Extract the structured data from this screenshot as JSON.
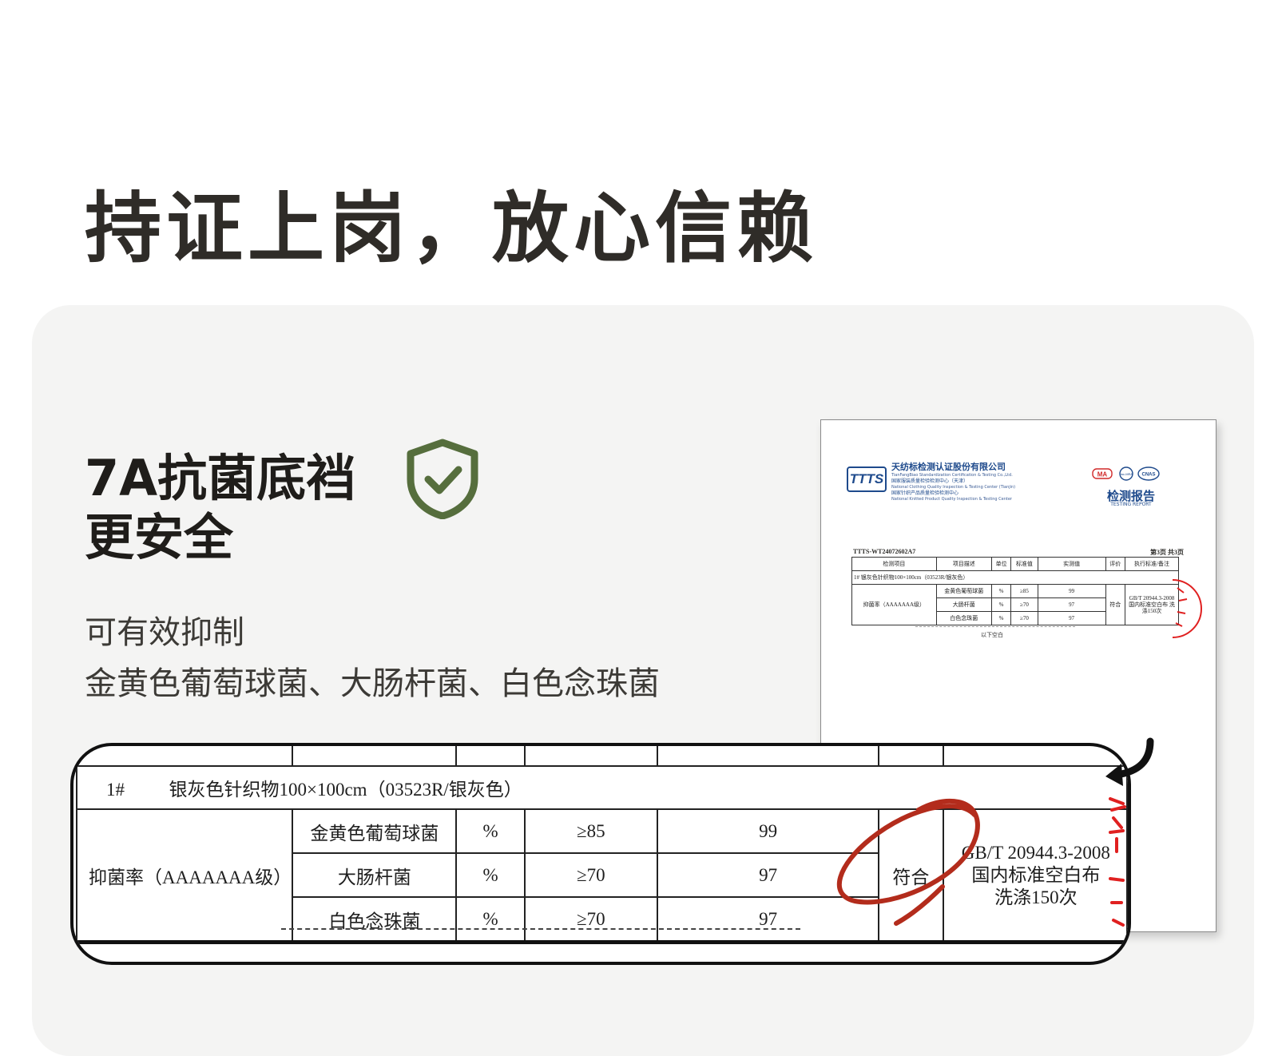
{
  "headline": "持证上岗，放心信赖",
  "feature": {
    "title_line1": "7A抗菌底裆",
    "title_line2": "更安全",
    "desc_line1": "可有效抑制",
    "desc_line2": "金黄色葡萄球菌、大肠杆菌、白色念珠菌"
  },
  "colors": {
    "shield": "#566e3d",
    "circle": "#b32c1c",
    "seal": "#e02020",
    "report_blue": "#1e4a8c"
  },
  "report": {
    "logo": "TTTS",
    "org_name": "天纺标检测认证股份有限公司",
    "org_sub": "TianFangBiao Standardization Certification & Testing Co.,Ltd.",
    "center1": "国家服装质量检验检测中心（天津）",
    "center1_en": "National Clothing Quality Inspection & Testing Center (Tianjin)",
    "center2": "国家针织产品质量检验检测中心",
    "center2_en": "National Knitted Product Quality Inspection & Testing Center",
    "badges": [
      "MA",
      "ilac-MRA",
      "CNAS"
    ],
    "doc_title": "检测报告",
    "doc_sub": "TESTING REPORT",
    "report_no": "TTTS-WT24072602A7",
    "page": "第3页 共3页",
    "headers": [
      "检测项目",
      "项目描述",
      "单位",
      "标准值",
      "实测值",
      "评价",
      "执行标准/备注"
    ],
    "sample_row": "1#     银灰色针织物100×100cm（03523R/银灰色）",
    "item": "抑菌率（AAAAAAA级）",
    "rows": [
      {
        "name": "金黄色葡萄球菌",
        "unit": "%",
        "standard": "≥85",
        "measured": "99"
      },
      {
        "name": "大肠杆菌",
        "unit": "%",
        "standard": "≥70",
        "measured": "97"
      },
      {
        "name": "白色念珠菌",
        "unit": "%",
        "standard": "≥70",
        "measured": "97"
      }
    ],
    "result": "符合",
    "std_note": "GB/T 20944.3-2008 国内标准空白布 洗涤150次",
    "end_note": "以下空白"
  },
  "zoom": {
    "sample_id": "1#",
    "sample_desc": "银灰色针织物100×100cm（03523R/银灰色）",
    "item": "抑菌率（AAAAAAA级）",
    "rows": [
      {
        "name": "金黄色葡萄球菌",
        "unit": "%",
        "standard": "≥85",
        "measured": "99"
      },
      {
        "name": "大肠杆菌",
        "unit": "%",
        "standard": "≥70",
        "measured": "97"
      },
      {
        "name": "白色念珠菌",
        "unit": "%",
        "standard": "≥70",
        "measured": "97"
      }
    ],
    "result": "符合",
    "std_line1": "GB/T  20944.3-2008",
    "std_line2": "国内标准空白布",
    "std_line3": "洗涤150次"
  }
}
